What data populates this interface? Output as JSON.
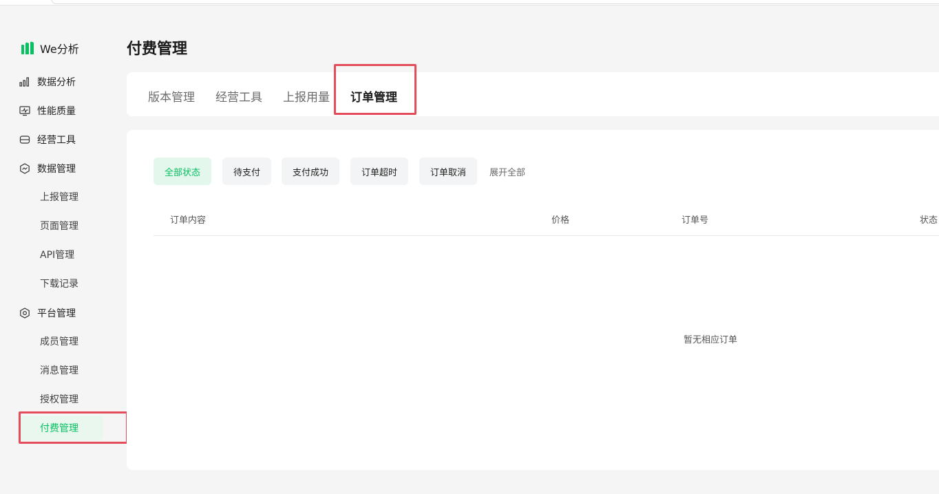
{
  "app": {
    "logo_text": "We分析"
  },
  "sidebar": {
    "items": [
      {
        "label": "数据分析",
        "icon": "bar-chart-icon"
      },
      {
        "label": "性能质量",
        "icon": "monitor-icon"
      },
      {
        "label": "经营工具",
        "icon": "store-icon"
      },
      {
        "label": "数据管理",
        "icon": "hexagon-chart-icon"
      },
      {
        "label": "上报管理"
      },
      {
        "label": "页面管理"
      },
      {
        "label": "API管理"
      },
      {
        "label": "下载记录"
      },
      {
        "label": "平台管理",
        "icon": "settings-hex-icon"
      },
      {
        "label": "成员管理"
      },
      {
        "label": "消息管理"
      },
      {
        "label": "授权管理"
      },
      {
        "label": "付费管理",
        "active": true
      }
    ]
  },
  "main": {
    "title": "付费管理",
    "tabs": [
      {
        "label": "版本管理"
      },
      {
        "label": "经营工具"
      },
      {
        "label": "上报用量"
      },
      {
        "label": "订单管理",
        "active": true
      }
    ],
    "filters": [
      {
        "label": "全部状态",
        "active": true
      },
      {
        "label": "待支付"
      },
      {
        "label": "支付成功"
      },
      {
        "label": "订单超时"
      },
      {
        "label": "订单取消"
      }
    ],
    "expand_label": "展开全部",
    "table": {
      "columns": [
        "订单内容",
        "价格",
        "订单号",
        "状态"
      ]
    },
    "empty_text": "暂无相应订单"
  },
  "colors": {
    "accent": "#07c160",
    "highlight": "#e34d59"
  }
}
